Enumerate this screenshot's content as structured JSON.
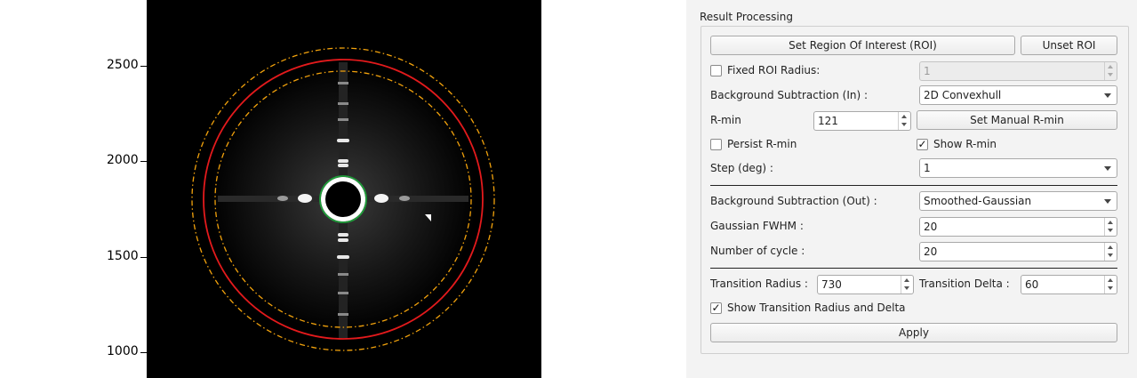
{
  "plot": {
    "y_ticks": [
      "2500",
      "2000",
      "1500",
      "1000"
    ]
  },
  "panel": {
    "title": "Result Processing",
    "set_roi_label": "Set Region Of Interest (ROI)",
    "unset_roi_label": "Unset ROI",
    "fixed_roi_label": "Fixed ROI Radius:",
    "fixed_roi_checked": false,
    "fixed_roi_value": "1",
    "bg_in_label": "Background Subtraction (In) :",
    "bg_in_value": "2D Convexhull",
    "rmin_label": "R-min",
    "rmin_value": "121",
    "set_manual_rmin_label": "Set Manual R-min",
    "persist_rmin_label": "Persist R-min",
    "persist_rmin_checked": false,
    "show_rmin_label": "Show R-min",
    "show_rmin_checked": true,
    "step_label": "Step (deg) :",
    "step_value": "1",
    "bg_out_label": "Background Subtraction (Out) :",
    "bg_out_value": "Smoothed-Gaussian",
    "gaussian_fwhm_label": "Gaussian FWHM :",
    "gaussian_fwhm_value": "20",
    "num_cycle_label": "Number of cycle :",
    "num_cycle_value": "20",
    "transition_radius_label": "Transition Radius :",
    "transition_radius_value": "730",
    "transition_delta_label": "Transition Delta :",
    "transition_delta_value": "60",
    "show_transition_label": "Show Transition Radius and Delta",
    "show_transition_checked": true,
    "apply_label": "Apply",
    "check_mark": "✓"
  },
  "colors": {
    "roi_circle": "#e31a1c",
    "transition_circle": "#f2a20c",
    "rmin_circle": "#1f9e3a"
  }
}
